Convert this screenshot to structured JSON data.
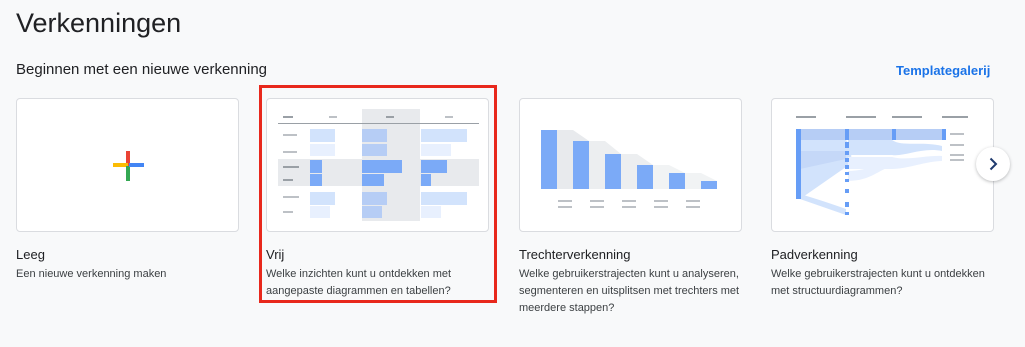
{
  "header": {
    "title": "Verkenningen",
    "subtitle": "Beginnen met een nieuwe verkenning",
    "gallery_link": "Templategalerij"
  },
  "cards": [
    {
      "title": "Leeg",
      "description": "Een nieuwe verkenning maken",
      "icon": "plus-icon"
    },
    {
      "title": "Vrij",
      "description": "Welke inzichten kunt u ontdekken met aangepaste diagrammen en tabellen?",
      "icon": "freeform-table-thumbnail",
      "highlighted": true
    },
    {
      "title": "Trechterverkenning",
      "description": "Welke gebruikerstrajecten kunt u analyseren, segmenteren en uitsplitsen met trechters met meerdere stappen?",
      "icon": "funnel-chart-thumbnail"
    },
    {
      "title": "Padverkenning",
      "description": "Welke gebruikerstrajecten kunt u ontdekken met structuurdiagrammen?",
      "icon": "path-tree-thumbnail"
    }
  ],
  "navigation": {
    "next_icon": "chevron-right-icon"
  },
  "colors": {
    "accent": "#1a73e8",
    "highlight_border": "#e8281c",
    "chart_blue": "#7baaf7",
    "chart_light_blue": "#d2e3fc",
    "plus_red": "#ea4335",
    "plus_yellow": "#fbbc04",
    "plus_green": "#34a853",
    "plus_blue": "#4285f4"
  }
}
